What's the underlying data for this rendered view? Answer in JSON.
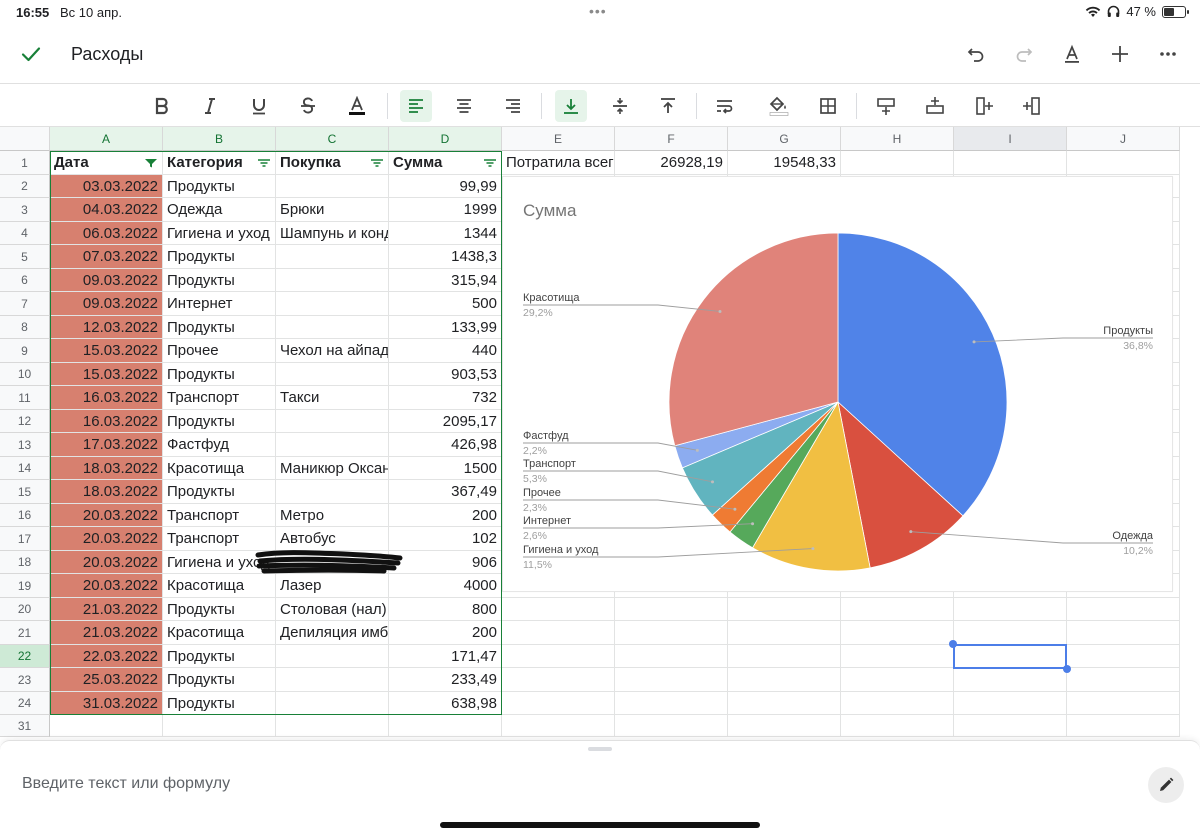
{
  "status": {
    "time": "16:55",
    "date": "Вс 10 апр.",
    "battery": "47 %"
  },
  "document": {
    "title": "Расходы"
  },
  "columns": [
    "A",
    "B",
    "C",
    "D",
    "E",
    "F",
    "G",
    "H",
    "I",
    "J"
  ],
  "header_row": {
    "row": "1",
    "date": "Дата",
    "category": "Категория",
    "purchase": "Покупка",
    "sum": "Сумма",
    "e": "Потратила всего",
    "f": "26928,19",
    "g": "19548,33"
  },
  "rows": [
    {
      "row": "2",
      "date": "03.03.2022",
      "category": "Продукты",
      "purchase": "",
      "sum": "99,99"
    },
    {
      "row": "3",
      "date": "04.03.2022",
      "category": "Одежда",
      "purchase": "Брюки",
      "sum": "1999"
    },
    {
      "row": "4",
      "date": "06.03.2022",
      "category": "Гигиена и уход",
      "purchase": "Шампунь и конд",
      "sum": "1344"
    },
    {
      "row": "5",
      "date": "07.03.2022",
      "category": "Продукты",
      "purchase": "",
      "sum": "1438,3"
    },
    {
      "row": "6",
      "date": "09.03.2022",
      "category": "Продукты",
      "purchase": "",
      "sum": "315,94"
    },
    {
      "row": "7",
      "date": "09.03.2022",
      "category": "Интернет",
      "purchase": "",
      "sum": "500"
    },
    {
      "row": "8",
      "date": "12.03.2022",
      "category": "Продукты",
      "purchase": "",
      "sum": "133,99"
    },
    {
      "row": "9",
      "date": "15.03.2022",
      "category": "Прочее",
      "purchase": "Чехол на айпад",
      "sum": "440"
    },
    {
      "row": "10",
      "date": "15.03.2022",
      "category": "Продукты",
      "purchase": "",
      "sum": "903,53"
    },
    {
      "row": "11",
      "date": "16.03.2022",
      "category": "Транспорт",
      "purchase": "Такси",
      "sum": "732"
    },
    {
      "row": "12",
      "date": "16.03.2022",
      "category": "Продукты",
      "purchase": "",
      "sum": "2095,17"
    },
    {
      "row": "13",
      "date": "17.03.2022",
      "category": "Фастфуд",
      "purchase": "",
      "sum": "426,98"
    },
    {
      "row": "14",
      "date": "18.03.2022",
      "category": "Красотища",
      "purchase": "Маникюр Оксана",
      "sum": "1500"
    },
    {
      "row": "15",
      "date": "18.03.2022",
      "category": "Продукты",
      "purchase": "",
      "sum": "367,49"
    },
    {
      "row": "16",
      "date": "20.03.2022",
      "category": "Транспорт",
      "purchase": "Метро",
      "sum": "200"
    },
    {
      "row": "17",
      "date": "20.03.2022",
      "category": "Транспорт",
      "purchase": "Автобус",
      "sum": "102"
    },
    {
      "row": "18",
      "date": "20.03.2022",
      "category": "Гигиена и уход",
      "purchase": "",
      "sum": "906"
    },
    {
      "row": "19",
      "date": "20.03.2022",
      "category": "Красотища",
      "purchase": "Лазер",
      "sum": "4000"
    },
    {
      "row": "20",
      "date": "21.03.2022",
      "category": "Продукты",
      "purchase": "Столовая (нал)",
      "sum": "800"
    },
    {
      "row": "21",
      "date": "21.03.2022",
      "category": "Красотища",
      "purchase": "Депиляция имби",
      "sum": "200"
    },
    {
      "row": "22",
      "date": "22.03.2022",
      "category": "Продукты",
      "purchase": "",
      "sum": "171,47"
    },
    {
      "row": "23",
      "date": "25.03.2022",
      "category": "Продукты",
      "purchase": "",
      "sum": "233,49"
    },
    {
      "row": "24",
      "date": "31.03.2022",
      "category": "Продукты",
      "purchase": "",
      "sum": "638,98"
    }
  ],
  "last_row_label": "31",
  "colors": {
    "accent_green": "#188038",
    "date_fill": "#d7806f",
    "selection_blue": "#4c7ee8"
  },
  "formula_bar": {
    "placeholder": "Введите текст или формулу"
  },
  "toolbar_icons": [
    "bold-icon",
    "italic-icon",
    "underline-icon",
    "strikethrough-icon",
    "text-color-icon",
    "align-left-icon",
    "align-center-icon",
    "align-right-icon",
    "valign-bottom-icon",
    "valign-middle-icon",
    "valign-top-icon",
    "wrap-icon",
    "fill-color-icon",
    "borders-icon",
    "insert-row-above-icon",
    "insert-row-below-icon",
    "insert-col-left-icon",
    "insert-col-right-icon"
  ],
  "chart_data": {
    "type": "pie",
    "title": "Сумма",
    "slices": [
      {
        "label": "Продукты",
        "value": 36.8,
        "pct": "36,8%",
        "color": "#5083e8"
      },
      {
        "label": "Одежда",
        "value": 10.2,
        "pct": "10,2%",
        "color": "#d9503f"
      },
      {
        "label": "Гигиена и уход",
        "value": 11.5,
        "pct": "11,5%",
        "color": "#f1bf42"
      },
      {
        "label": "Интернет",
        "value": 2.6,
        "pct": "2,6%",
        "color": "#56a95b"
      },
      {
        "label": "Прочее",
        "value": 2.3,
        "pct": "2,3%",
        "color": "#ef7b33"
      },
      {
        "label": "Транспорт",
        "value": 5.3,
        "pct": "5,3%",
        "color": "#61b4bf"
      },
      {
        "label": "Фастфуд",
        "value": 2.2,
        "pct": "2,2%",
        "color": "#8cacf0"
      },
      {
        "label": "Красотища",
        "value": 29.2,
        "pct": "29,2%",
        "color": "#e0837a"
      }
    ],
    "legend": "labels-with-leader-lines"
  }
}
